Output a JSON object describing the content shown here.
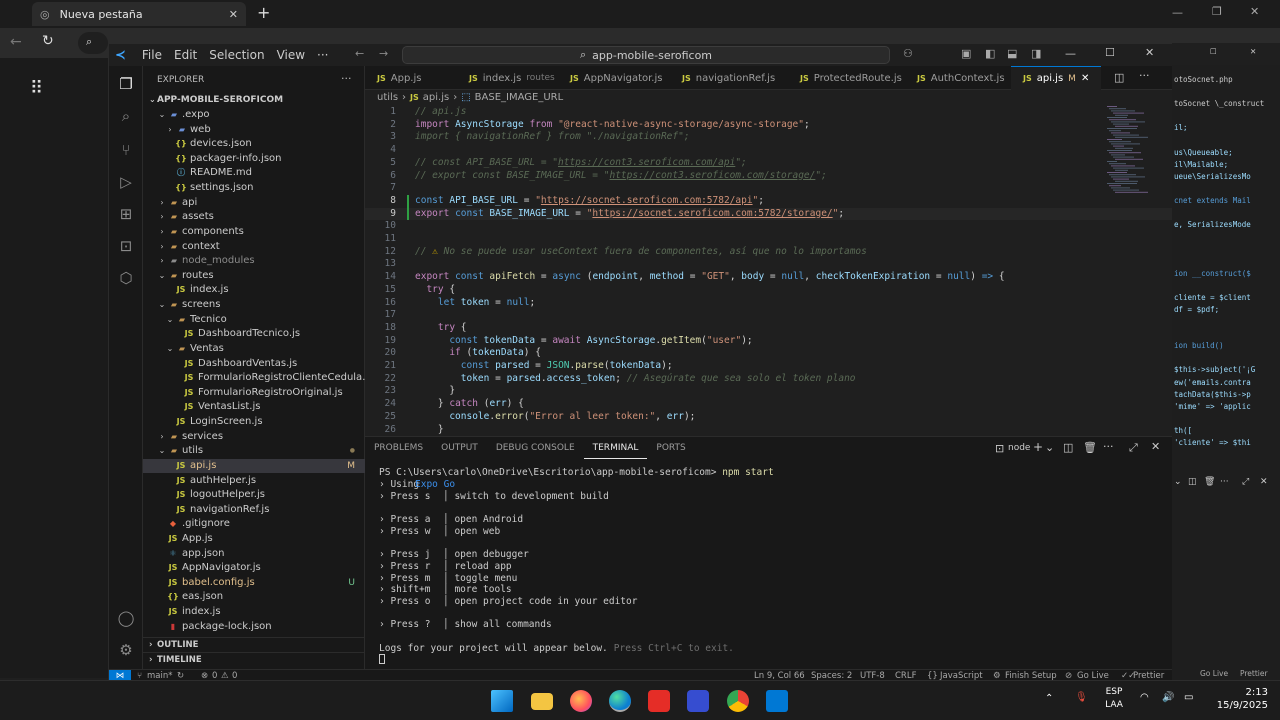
{
  "browser": {
    "tab_title": "Nueva pestaña",
    "new_tab": "+"
  },
  "vscode": {
    "menu": [
      "File",
      "Edit",
      "Selection",
      "View",
      "···"
    ],
    "command_center": "app-mobile-seroficom",
    "explorer_title": "EXPLORER",
    "root_folder": "APP-MOBILE-SEROFICOM",
    "tree": [
      {
        "label": ".expo",
        "type": "folder",
        "depth": 1,
        "open": true,
        "color": "#6b8fd6"
      },
      {
        "label": "web",
        "type": "folder",
        "depth": 2,
        "open": false,
        "color": "#6b8fd6"
      },
      {
        "label": "devices.json",
        "type": "json",
        "depth": 2
      },
      {
        "label": "packager-info.json",
        "type": "json",
        "depth": 2
      },
      {
        "label": "README.md",
        "type": "md",
        "depth": 2
      },
      {
        "label": "settings.json",
        "type": "json",
        "depth": 2
      },
      {
        "label": "api",
        "type": "folder",
        "depth": 1,
        "open": false
      },
      {
        "label": "assets",
        "type": "folder",
        "depth": 1,
        "open": false
      },
      {
        "label": "components",
        "type": "folder",
        "depth": 1,
        "open": false
      },
      {
        "label": "context",
        "type": "folder",
        "depth": 1,
        "open": false
      },
      {
        "label": "node_modules",
        "type": "folder",
        "depth": 1,
        "open": false,
        "color": "#8b8b8b"
      },
      {
        "label": "routes",
        "type": "folder",
        "depth": 1,
        "open": true
      },
      {
        "label": "index.js",
        "type": "js",
        "depth": 2
      },
      {
        "label": "screens",
        "type": "folder",
        "depth": 1,
        "open": true
      },
      {
        "label": "Tecnico",
        "type": "folder",
        "depth": 2,
        "open": true
      },
      {
        "label": "DashboardTecnico.js",
        "type": "js",
        "depth": 3
      },
      {
        "label": "Ventas",
        "type": "folder",
        "depth": 2,
        "open": true
      },
      {
        "label": "DashboardVentas.js",
        "type": "js",
        "depth": 3
      },
      {
        "label": "FormularioRegistroClienteCedula.js",
        "type": "js",
        "depth": 3
      },
      {
        "label": "FormularioRegistroOriginal.js",
        "type": "js",
        "depth": 3
      },
      {
        "label": "VentasList.js",
        "type": "js",
        "depth": 3
      },
      {
        "label": "LoginScreen.js",
        "type": "js",
        "depth": 2
      },
      {
        "label": "services",
        "type": "folder",
        "depth": 1,
        "open": false
      },
      {
        "label": "utils",
        "type": "folder",
        "depth": 1,
        "open": true,
        "dot": true
      },
      {
        "label": "api.js",
        "type": "js",
        "depth": 2,
        "badge": "M",
        "selected": true
      },
      {
        "label": "authHelper.js",
        "type": "js",
        "depth": 2
      },
      {
        "label": "logoutHelper.js",
        "type": "js",
        "depth": 2
      },
      {
        "label": "navigationRef.js",
        "type": "js",
        "depth": 2
      },
      {
        "label": ".gitignore",
        "type": "git",
        "depth": 1
      },
      {
        "label": "App.js",
        "type": "js",
        "depth": 1
      },
      {
        "label": "app.json",
        "type": "react",
        "depth": 1
      },
      {
        "label": "AppNavigator.js",
        "type": "js",
        "depth": 1
      },
      {
        "label": "babel.config.js",
        "type": "js",
        "depth": 1,
        "badge": "U",
        "color_label": "#e2c08d"
      },
      {
        "label": "eas.json",
        "type": "json",
        "depth": 1
      },
      {
        "label": "index.js",
        "type": "js",
        "depth": 1
      },
      {
        "label": "package-lock.json",
        "type": "npm",
        "depth": 1
      }
    ],
    "outline_label": "OUTLINE",
    "timeline_label": "TIMELINE",
    "tabs": [
      {
        "label": "App.js",
        "extra": ""
      },
      {
        "label": "index.js",
        "extra": "routes"
      },
      {
        "label": "AppNavigator.js",
        "extra": ""
      },
      {
        "label": "navigationRef.js",
        "extra": ""
      },
      {
        "label": "ProtectedRoute.js",
        "extra": ""
      },
      {
        "label": "AuthContext.js",
        "extra": ""
      },
      {
        "label": "api.js",
        "extra": "M"
      }
    ],
    "breadcrumb": [
      "utils",
      "api.js",
      "BASE_IMAGE_URL"
    ],
    "code_lines": [
      "1",
      "2",
      "3",
      "4",
      "5",
      "6",
      "7",
      "8",
      "9",
      "10",
      "11",
      "12",
      "13",
      "14",
      "15",
      "16",
      "17",
      "18",
      "19",
      "20",
      "21",
      "22",
      "23",
      "24",
      "25",
      "26"
    ],
    "panel_tabs": [
      "PROBLEMS",
      "OUTPUT",
      "DEBUG CONSOLE",
      "TERMINAL",
      "PORTS"
    ],
    "panel_shell": "node",
    "terminal": {
      "prompt": "PS C:\\Users\\carlo\\OneDrive\\Escritorio\\app-mobile-seroficom>",
      "command": "npm start",
      "lines": [
        {
          "key": "› Using",
          "val": "Expo Go",
          "accent": true
        },
        {
          "key": "› Press s",
          "val": "│ switch to development build"
        },
        {
          "key": "",
          "val": ""
        },
        {
          "key": "› Press a",
          "val": "│ open Android"
        },
        {
          "key": "› Press w",
          "val": "│ open web"
        },
        {
          "key": "",
          "val": ""
        },
        {
          "key": "› Press j",
          "val": "│ open debugger"
        },
        {
          "key": "› Press r",
          "val": "│ reload app"
        },
        {
          "key": "› Press m",
          "val": "│ toggle menu"
        },
        {
          "key": "› shift+m",
          "val": "│ more tools"
        },
        {
          "key": "› Press o",
          "val": "│ open project code in your editor"
        },
        {
          "key": "",
          "val": ""
        },
        {
          "key": "› Press ?",
          "val": "│ show all commands"
        },
        {
          "key": "",
          "val": ""
        },
        {
          "key": "Logs for your project will appear below.",
          "val": "Press Ctrl+C to exit.",
          "dim": true
        }
      ]
    },
    "status": {
      "branch": "main*",
      "errors": "0",
      "warnings": "0",
      "position": "Ln 9, Col 66",
      "spaces": "Spaces: 2",
      "encoding": "UTF-8",
      "eol": "CRLF",
      "language": "JavaScript",
      "finish_setup": "Finish Setup",
      "go_live": "Go Live",
      "prettier": "Prettier"
    }
  },
  "right_window": {
    "lines": [
      "otoSocnet.php",
      "",
      "toSocnet \\_construct",
      "",
      "il;",
      "",
      "us\\Queueable;",
      "il\\Mailable;",
      "ueue\\SerializesMo",
      "",
      "cnet extends Mail",
      "",
      "e, SerializesMode",
      "",
      "",
      "",
      "ion __construct($",
      "",
      "cliente = $client",
      "df = $pdf;",
      "",
      "",
      "ion build()",
      "",
      "$this->subject('¡G",
      "ew('emails.contra",
      "tachData($this->p",
      "'mime' => 'applic",
      "",
      "th([",
      "'cliente' => $thi"
    ],
    "go_live": "Go Live",
    "prettier": "Prettier"
  },
  "taskbar": {
    "lang": "ESP",
    "region": "LAA",
    "time": "2:13",
    "date": "15/9/2025"
  },
  "colors": {
    "accent": "#0078d4",
    "js_icon": "#cbcb41",
    "modified": "#e2c08d"
  }
}
